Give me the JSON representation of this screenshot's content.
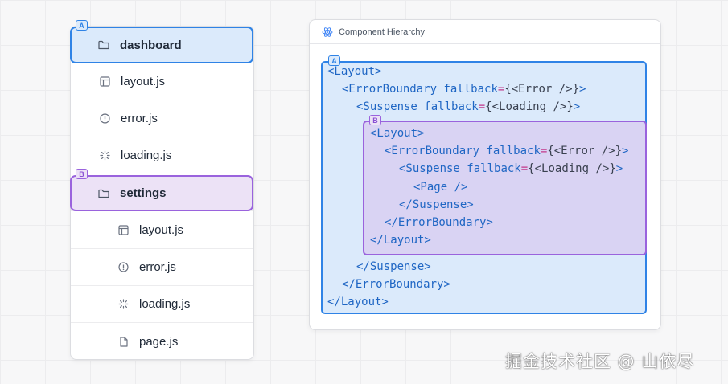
{
  "file_tree": {
    "dashboard": {
      "label": "dashboard",
      "badge": "A"
    },
    "dashboard_files": [
      {
        "label": "layout.js",
        "icon": "layout-icon"
      },
      {
        "label": "error.js",
        "icon": "error-icon"
      },
      {
        "label": "loading.js",
        "icon": "loading-icon"
      }
    ],
    "settings": {
      "label": "settings",
      "badge": "B"
    },
    "settings_files": [
      {
        "label": "layout.js",
        "icon": "layout-icon"
      },
      {
        "label": "error.js",
        "icon": "error-icon"
      },
      {
        "label": "loading.js",
        "icon": "loading-icon"
      },
      {
        "label": "page.js",
        "icon": "file-icon"
      }
    ]
  },
  "hierarchy": {
    "title": "Component Hierarchy",
    "badge_a": "A",
    "badge_b": "B",
    "lines": [
      {
        "tag": "<Layout>"
      },
      {
        "tag": "<ErrorBoundary",
        "attr": "fallback",
        "value": "{<Error />}",
        "close": ">"
      },
      {
        "tag": "<Suspense",
        "attr": "fallback",
        "value": "{<Loading />}",
        "close": ">"
      },
      {
        "tag": "<Layout>"
      },
      {
        "tag": "<ErrorBoundary",
        "attr": "fallback",
        "value": "{<Error />}",
        "close": ">"
      },
      {
        "tag": "<Suspense",
        "attr": "fallback",
        "value": "{<Loading />}",
        "close": ">"
      },
      {
        "tag": "<Page />"
      },
      {
        "tag": "</Suspense>"
      },
      {
        "tag": "</ErrorBoundary>"
      },
      {
        "tag": "</Layout>"
      },
      {
        "tag": "</Suspense>"
      },
      {
        "tag": "</ErrorBoundary>"
      },
      {
        "tag": "</Layout>"
      }
    ]
  },
  "watermark": "掘金技术社区 @ 山依尽",
  "colors": {
    "segment_a": "#2f83e6",
    "segment_b": "#9a63dd",
    "code_tag": "#1f66c4",
    "code_punct": "#c2378a"
  }
}
